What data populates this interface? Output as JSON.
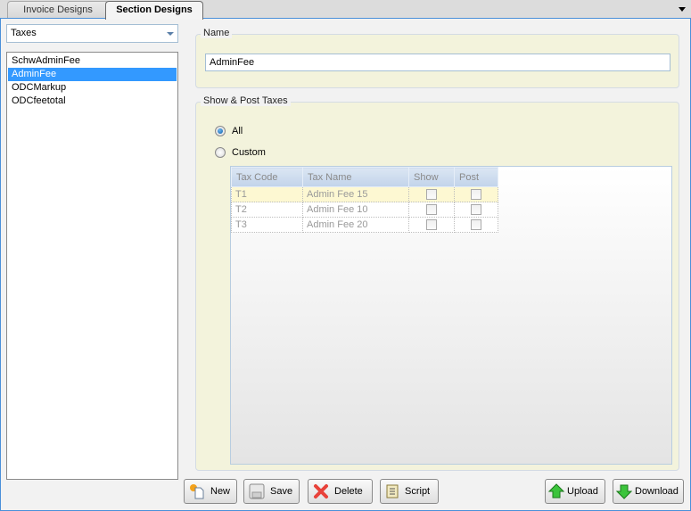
{
  "tabs": [
    {
      "label": "Invoice Designs",
      "active": false
    },
    {
      "label": "Section Designs",
      "active": true
    }
  ],
  "section_type": {
    "selected": "Taxes"
  },
  "sections": [
    {
      "label": "SchwAdminFee",
      "selected": false
    },
    {
      "label": "AdminFee",
      "selected": true
    },
    {
      "label": "ODCMarkup",
      "selected": false
    },
    {
      "label": "ODCfeetotal",
      "selected": false
    }
  ],
  "name_group": {
    "title": "Name",
    "value": "AdminFee"
  },
  "taxes_group": {
    "title": "Show & Post Taxes",
    "radio_all": "All",
    "radio_custom": "Custom",
    "selected_option": "All",
    "columns": [
      "Tax Code",
      "Tax Name",
      "Show",
      "Post"
    ],
    "rows": [
      {
        "code": "T1",
        "name": "Admin Fee 15",
        "show": false,
        "post": false
      },
      {
        "code": "T2",
        "name": "Admin Fee 10",
        "show": false,
        "post": false
      },
      {
        "code": "T3",
        "name": "Admin Fee 20",
        "show": false,
        "post": false
      }
    ]
  },
  "buttons": {
    "new": "New",
    "save": "Save",
    "delete": "Delete",
    "script": "Script",
    "upload": "Upload",
    "download": "Download"
  }
}
